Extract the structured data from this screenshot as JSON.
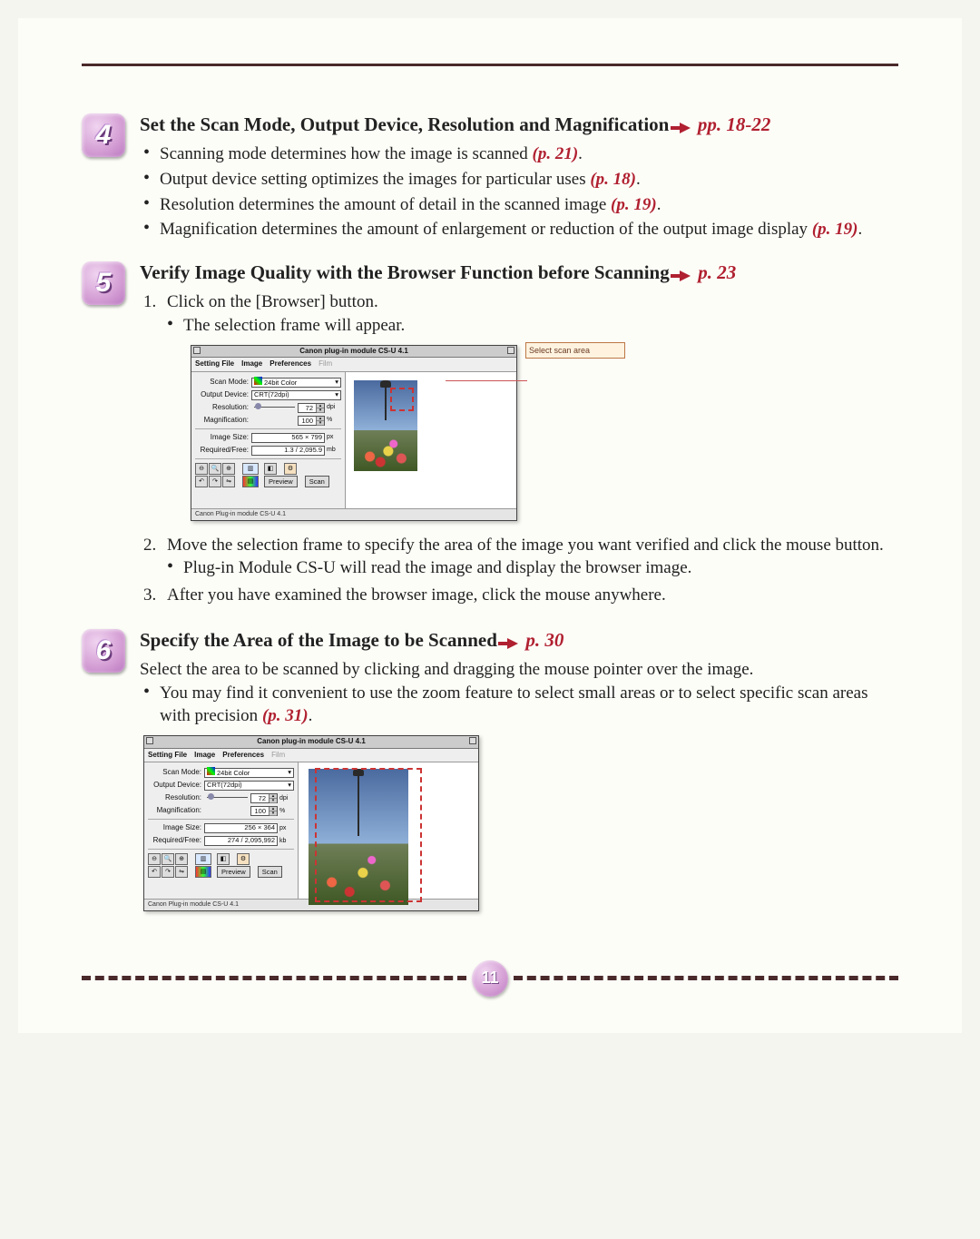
{
  "page_number": "11",
  "sections": [
    {
      "badge": "4",
      "title_a": "Set the Scan Mode, Output Device, Resolution and Magnification",
      "title_ref": "pp. 18-22",
      "bullets": [
        {
          "text": "Scanning mode determines how the image is scanned ",
          "ref": "(p. 21)",
          "tail": "."
        },
        {
          "text": "Output device setting optimizes the images for particular uses ",
          "ref": "(p. 18)",
          "tail": "."
        },
        {
          "text": "Resolution determines the amount of detail in the scanned image ",
          "ref": "(p. 19)",
          "tail": "."
        },
        {
          "text": "Magnification determines the amount of enlargement or reduction of the output image display ",
          "ref": "(p. 19)",
          "tail": "."
        }
      ]
    },
    {
      "badge": "5",
      "title_a": "Verify Image Quality with the Browser Function before Scanning",
      "title_ref": "p. 23",
      "steps": [
        {
          "num": "1.",
          "text": "Click on the [Browser] button.",
          "sub": [
            "The selection frame will appear."
          ]
        },
        {
          "num": "2.",
          "text": "Move the selection frame to specify the area of the image you want verified and click the mouse button.",
          "sub": [
            "Plug-in Module CS-U will read the image and display the browser image."
          ]
        },
        {
          "num": "3.",
          "text": "After you have examined the browser image, click the mouse anywhere.",
          "sub": []
        }
      ]
    },
    {
      "badge": "6",
      "title_a": "Specify the Area of the Image to be Scanned",
      "title_ref": "p. 30",
      "para": "Select the area to be scanned by clicking and dragging the mouse pointer over the image.",
      "bullets6": [
        {
          "text": "You may find it convenient to use the zoom feature to select small areas or to select specific scan areas with precision ",
          "ref": "(p. 31)",
          "tail": "."
        }
      ]
    }
  ],
  "screenshot1": {
    "title": "Canon plug-in module CS-U 4.1",
    "menus": [
      "Setting File",
      "Image",
      "Preferences",
      "Film"
    ],
    "callout": "Select scan area",
    "fields": {
      "scan_mode_lbl": "Scan Mode:",
      "scan_mode_val": "24bit Color",
      "output_lbl": "Output Device:",
      "output_val": "CRT(72dpi)",
      "resolution_lbl": "Resolution:",
      "resolution_val": "72",
      "resolution_unit": "dpi",
      "magnification_lbl": "Magnification:",
      "magnification_val": "100",
      "magnification_unit": "%",
      "image_size_lbl": "Image Size:",
      "image_size_val": "565 × 799",
      "image_size_unit": "px",
      "required_lbl": "Required/Free:",
      "required_val": "1.3 / 2,095.9",
      "required_unit": "mb"
    },
    "buttons": {
      "preview": "Preview",
      "scan": "Scan"
    },
    "footer": "Canon Plug-in module CS-U 4.1"
  },
  "screenshot2": {
    "title": "Canon plug-in module CS-U 4.1",
    "menus": [
      "Setting File",
      "Image",
      "Preferences",
      "Film"
    ],
    "fields": {
      "scan_mode_lbl": "Scan Mode:",
      "scan_mode_val": "24bit Color",
      "output_lbl": "Output Device:",
      "output_val": "CRT(72dpi)",
      "resolution_lbl": "Resolution:",
      "resolution_val": "72",
      "resolution_unit": "dpi",
      "magnification_lbl": "Magnification:",
      "magnification_val": "100",
      "magnification_unit": "%",
      "image_size_lbl": "Image Size:",
      "image_size_val": "256 × 364",
      "image_size_unit": "px",
      "required_lbl": "Required/Free:",
      "required_val": "274 / 2,095,992",
      "required_unit": "kb"
    },
    "buttons": {
      "preview": "Preview",
      "scan": "Scan"
    },
    "footer": "Canon Plug-in module CS-U 4.1"
  }
}
